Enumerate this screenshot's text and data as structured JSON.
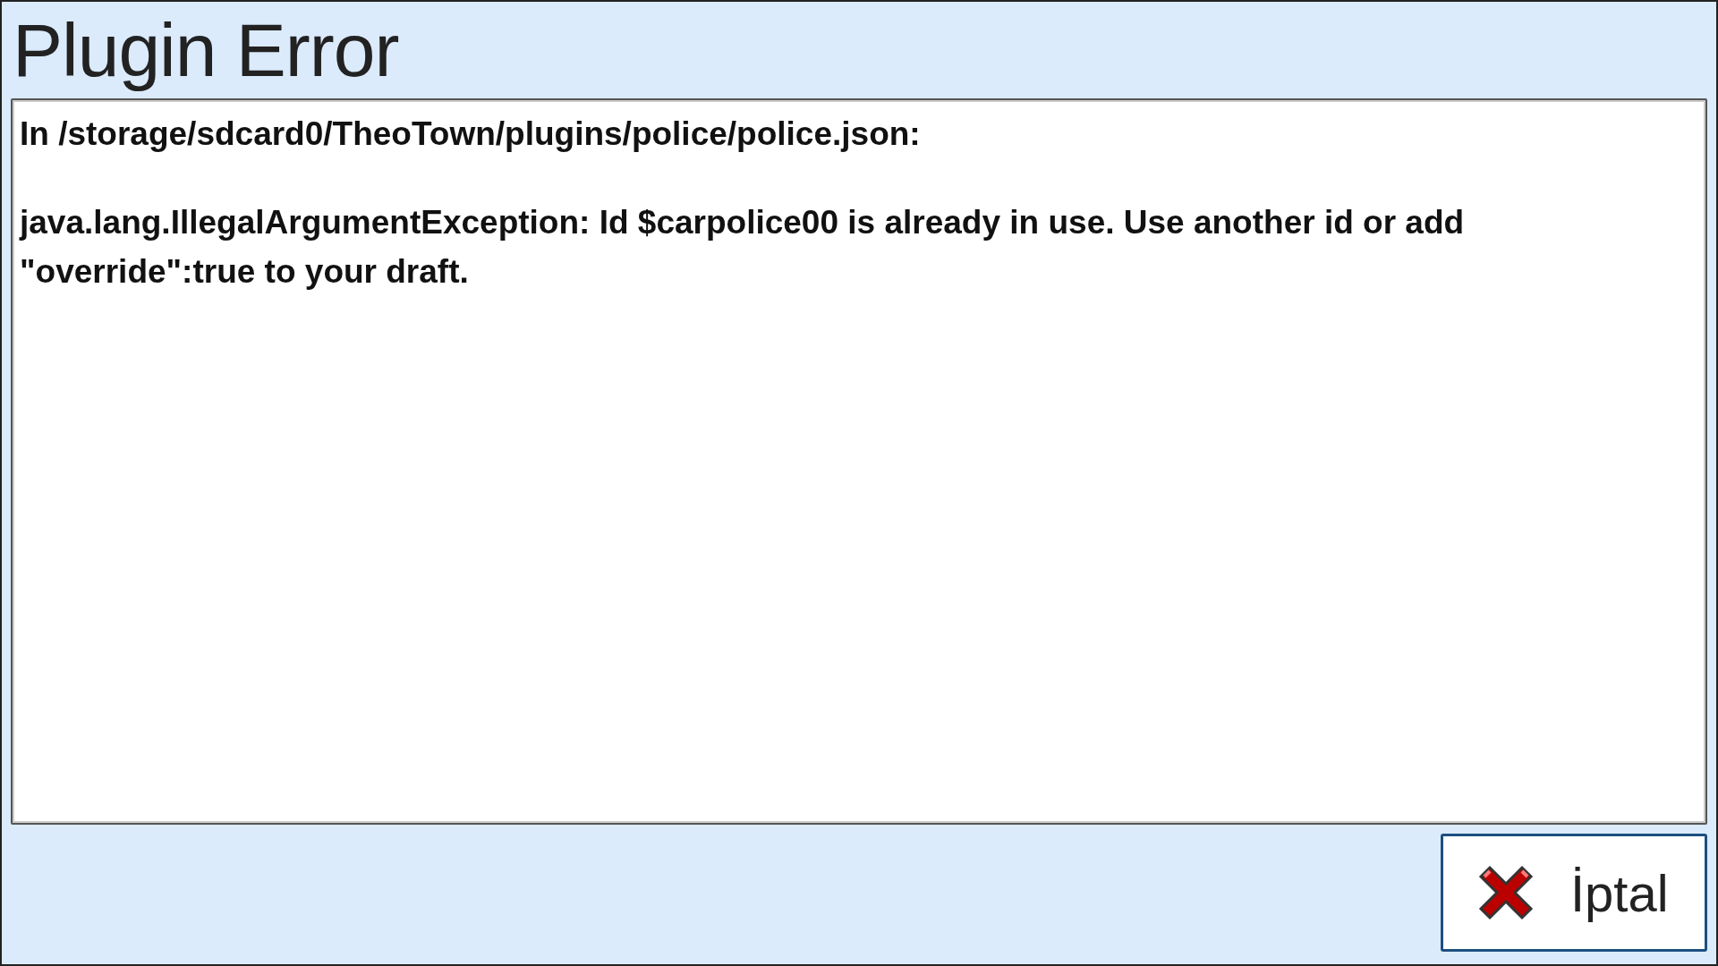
{
  "dialog": {
    "title": "Plugin Error",
    "message_lines": [
      "In /storage/sdcard0/TheoTown/plugins/police/police.json:",
      "java.lang.IllegalArgumentException: Id $carpolice00 is already in use. Use another id or add \"override\":true to your draft."
    ],
    "buttons": [
      {
        "label": "İptal",
        "kind": "cancel"
      }
    ]
  }
}
